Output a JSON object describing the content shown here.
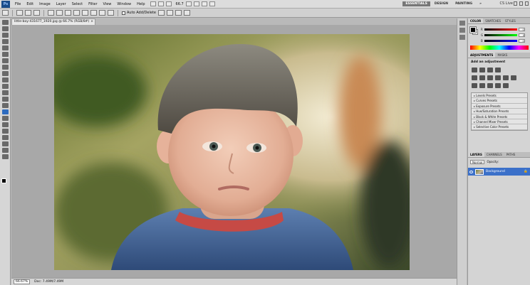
{
  "app": {
    "logo": "Ps",
    "zoom_display": "66.7"
  },
  "menu": [
    "File",
    "Edit",
    "Image",
    "Layer",
    "Select",
    "Filter",
    "View",
    "Window",
    "Help"
  ],
  "workspaces": {
    "items": [
      "ESSENTIALS",
      "DESIGN",
      "PAINTING"
    ],
    "more": "»",
    "active": "ESSENTIALS"
  },
  "cs_live": "CS Live",
  "options_bar": {
    "auto_add_delete_label": "Auto Add/Delete"
  },
  "document": {
    "tab_title": "little-boy-431677_1920.jpg @ 66.7% (RGB/8#)",
    "tab_close": "×",
    "status_zoom": "66.67%",
    "status_doc": "Doc: 7.49M/7.49M"
  },
  "panels": {
    "color": {
      "tabs": [
        "COLOR",
        "SWATCHES",
        "STYLES"
      ],
      "channels": [
        "R",
        "G",
        "B"
      ],
      "values": [
        "0",
        "0",
        "0"
      ]
    },
    "adjustments": {
      "tabs": [
        "ADJUSTMENTS",
        "MASKS"
      ],
      "title": "Add an adjustment",
      "presets": [
        "Levels Presets",
        "Curves Presets",
        "Exposure Presets",
        "Hue/Saturation Presets",
        "Black & White Presets",
        "Channel Mixer Presets",
        "Selective Color Presets"
      ]
    },
    "layers": {
      "tabs": [
        "LAYERS",
        "CHANNELS",
        "PATHS"
      ],
      "blend_mode": "Normal",
      "opacity_label": "Opacity:",
      "layer_name": "Background",
      "lock_glyph": "🔒"
    }
  },
  "colors": {
    "accent": "#3b70c9",
    "chrome": "#d4d4d4"
  }
}
